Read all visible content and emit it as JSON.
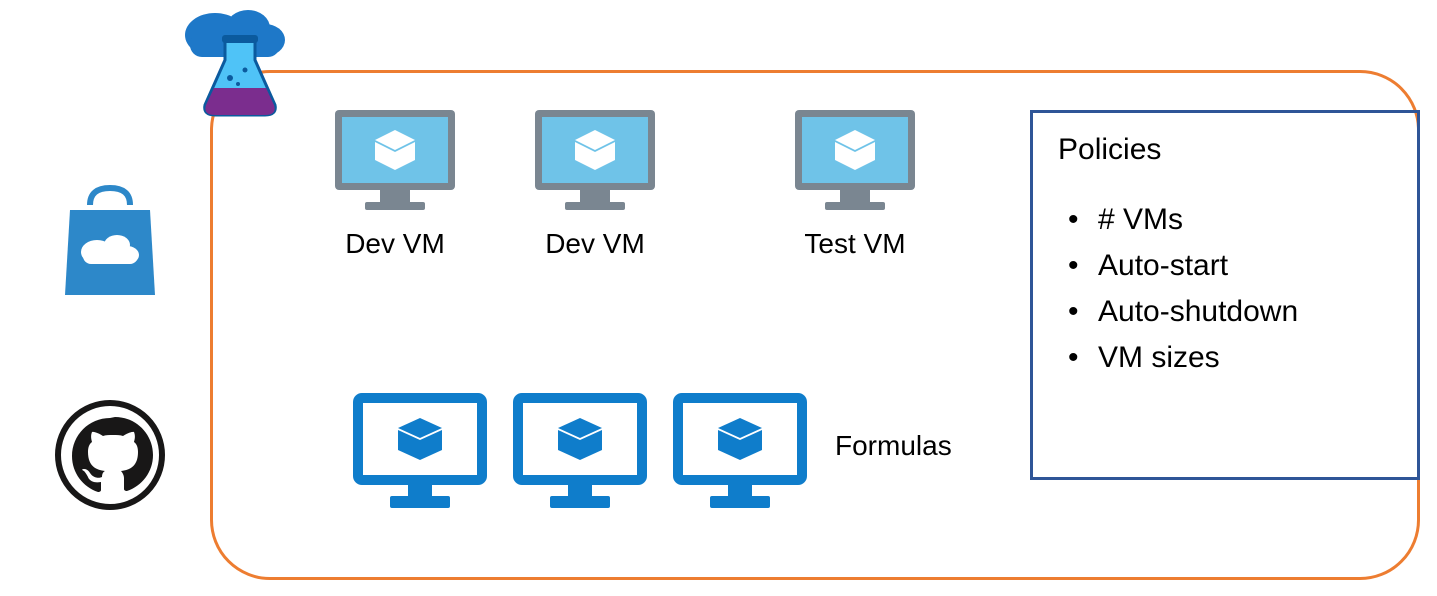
{
  "vms": [
    {
      "label": "Dev VM"
    },
    {
      "label": "Dev VM"
    },
    {
      "label": "Test VM"
    }
  ],
  "formulas_label": "Formulas",
  "policies": {
    "title": "Policies",
    "items": [
      "# VMs",
      "Auto-start",
      "Auto-shutdown",
      "VM sizes"
    ]
  }
}
